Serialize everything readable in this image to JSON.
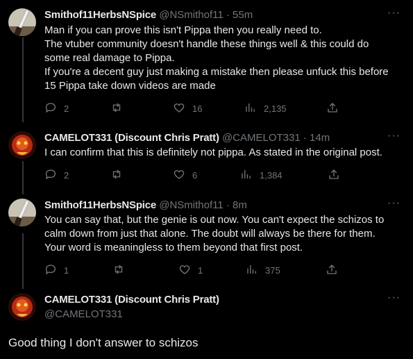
{
  "tweets": [
    {
      "name": "Smithof11HerbsNSpice",
      "handle": "@NSmithof11",
      "time": "· 55m",
      "lines": [
        "Man if you can prove this isn't Pippa then you really need to.",
        "The vtuber community doesn't handle these things well & this could do",
        "some real damage to Pippa.",
        "If you're a decent guy just making a mistake then please unfuck this before",
        "15 Pippa take down videos are made"
      ],
      "replies": "2",
      "retweets": "",
      "likes": "16",
      "views": "2,135",
      "avatar": "knife"
    },
    {
      "name": "CAMELOT331 (Discount Chris Pratt)",
      "handle": "@CAMELOT331",
      "time": "· 14m",
      "lines": [
        "I can confirm that this is definitely not pippa. As stated in the original post."
      ],
      "replies": "2",
      "retweets": "",
      "likes": "6",
      "views": "1,384",
      "avatar": "red-face"
    },
    {
      "name": "Smithof11HerbsNSpice",
      "handle": "@NSmithof11",
      "time": "· 8m",
      "lines": [
        "You can say that, but the genie is out now. You can't expect the schizos to",
        "calm down from just that alone. The doubt will always be there for them.",
        "Your word is meaningless to them beyond that first post."
      ],
      "replies": "1",
      "retweets": "",
      "likes": "1",
      "views": "375",
      "avatar": "knife"
    }
  ],
  "main_tweet": {
    "name": "CAMELOT331 (Discount Chris Pratt)",
    "handle": "@CAMELOT331",
    "text": "Good thing I don't answer to schizos"
  },
  "more_label": "···",
  "colors": {
    "background": "#000000",
    "text": "#e7e9ea",
    "secondary": "#71767b",
    "thread_line": "#333639"
  },
  "icons": [
    "reply-icon",
    "retweet-icon",
    "like-icon",
    "views-icon",
    "share-icon",
    "more-icon"
  ]
}
